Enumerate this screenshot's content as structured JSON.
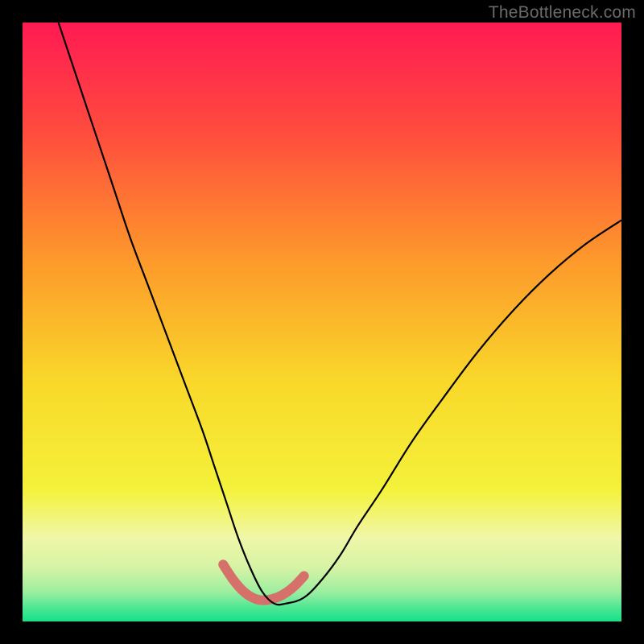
{
  "watermark": "TheBottleneck.com",
  "chart_data": {
    "type": "line",
    "title": "",
    "xlabel": "",
    "ylabel": "",
    "xlim": [
      0,
      100
    ],
    "ylim": [
      0,
      100
    ],
    "grid": false,
    "legend": false,
    "background_gradient_stops": [
      {
        "pct": 0,
        "color": "#ff1a53"
      },
      {
        "pct": 18,
        "color": "#ff4b3e"
      },
      {
        "pct": 40,
        "color": "#fd9a2b"
      },
      {
        "pct": 60,
        "color": "#f9d82a"
      },
      {
        "pct": 78,
        "color": "#f4f23a"
      },
      {
        "pct": 86,
        "color": "#f0f7a8"
      },
      {
        "pct": 91,
        "color": "#d6f3a5"
      },
      {
        "pct": 95,
        "color": "#9eeea0"
      },
      {
        "pct": 98,
        "color": "#46e693"
      },
      {
        "pct": 100,
        "color": "#18df8a"
      }
    ],
    "series": [
      {
        "name": "bottleneck-curve",
        "color": "#000000",
        "width": 2.2,
        "x": [
          6,
          9,
          12,
          15,
          18,
          21,
          24,
          27,
          30,
          32,
          34,
          36,
          38,
          40,
          42,
          44,
          47,
          50,
          53,
          56,
          60,
          65,
          70,
          76,
          82,
          88,
          94,
          100
        ],
        "y": [
          100,
          91,
          82,
          73,
          64,
          56,
          48,
          40,
          32,
          26,
          20,
          14,
          9,
          5,
          3,
          3,
          4,
          7,
          11,
          16,
          22,
          30,
          37,
          45,
          52,
          58,
          63,
          67
        ]
      },
      {
        "name": "optimal-range-highlight",
        "color": "#d5706b",
        "width": 12,
        "linecap": "round",
        "x": [
          33.5,
          35,
          36.5,
          38,
          39.5,
          41,
          42.5,
          44,
          45.5,
          47
        ],
        "y": [
          9.5,
          7.2,
          5.4,
          4.2,
          3.6,
          3.6,
          4.0,
          4.8,
          6.0,
          7.6
        ]
      }
    ]
  }
}
